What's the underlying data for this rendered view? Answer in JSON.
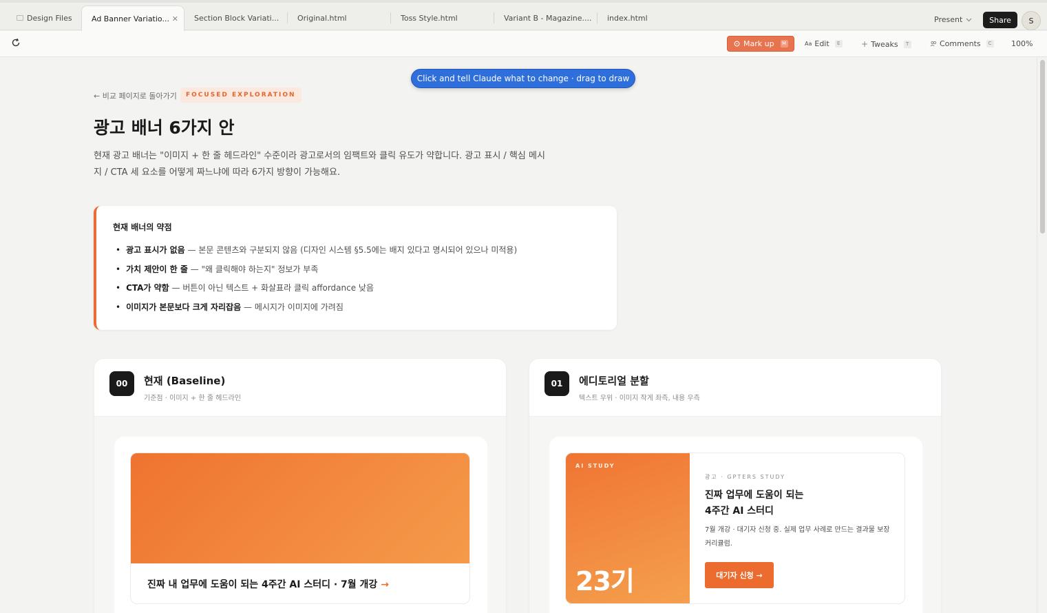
{
  "tabs": [
    {
      "label": "Design Files"
    },
    {
      "label": "Ad Banner Variatio...",
      "active": true
    },
    {
      "label": "Section Block Variati..."
    },
    {
      "label": "Original.html"
    },
    {
      "label": "Toss Style.html"
    },
    {
      "label": "Variant B - Magazine...."
    },
    {
      "label": "index.html"
    }
  ],
  "header": {
    "present_label": "Present",
    "share_label": "Share",
    "avatar_initial": "S"
  },
  "toolbar": {
    "markup_label": "Mark up",
    "markup_key": "M",
    "edit_label": "Edit",
    "edit_key": "E",
    "tweaks_label": "Tweaks",
    "tweaks_key": "T",
    "comments_label": "Comments",
    "comments_key": "C",
    "zoom": "100%"
  },
  "hint": "Click and tell Claude what to change · drag to draw",
  "page": {
    "back_link": "← 비교 페이지로 돌아가기",
    "badge": "FOCUSED EXPLORATION",
    "title": "광고 배너 6가지 안",
    "description": "현재 광고 배너는 \"이미지 + 한 줄 헤드라인\" 수준이라 광고로서의 임팩트와 클릭 유도가 약합니다. 광고 표시 / 핵심 메시지 / CTA 세 요소를 어떻게 짜느냐에 따라 6가지 방향이 가능해요."
  },
  "weaknesses": {
    "title": "현재 배너의 약점",
    "items": [
      {
        "bold": "광고 표시가 없음",
        "text": " — 본문 콘텐츠와 구분되지 않음 (디자인 시스템 §5.5에는 배지 있다고 명시되어 있으나 미적용)"
      },
      {
        "bold": "가치 제안이 한 줄",
        "text": " — \"왜 클릭해야 하는지\" 정보가 부족"
      },
      {
        "bold": "CTA가 약함",
        "text": " — 버튼이 아닌 텍스트 + 화살표라 클릭 affordance 낮음"
      },
      {
        "bold": "이미지가 본문보다 크게 자리잡음",
        "text": " — 메시지가 이미지에 가려짐"
      }
    ]
  },
  "cards": [
    {
      "num": "00",
      "title": "현재 (Baseline)",
      "subtitle": "기준점 · 이미지 + 한 줄 헤드라인",
      "banner_headline": "진짜 내 업무에 도움이 되는 4주간 AI 스터디 · 7월 개강",
      "banner_arrow": "→"
    },
    {
      "num": "01",
      "title": "에디토리얼 분할",
      "subtitle": "텍스트 우위 · 이미지 작게 좌측, 내용 우측",
      "banner_tag": "AI STUDY",
      "banner_big": "23기",
      "banner_label": "광고 · GPTERS STUDY",
      "banner_headline_1": "진짜 업무에 도움이 되는",
      "banner_headline_2": "4주간 AI 스터디",
      "banner_desc": "7월 개강 · 대기자 신청 중. 실제 업무 사례로 만드는 결과물 보장 커리큘럼.",
      "banner_cta": "대기자 신청 →"
    }
  ],
  "colors": {
    "accent": "#ec6b2f",
    "hint_blue": "#2f6fdc",
    "markup": "#e8734f"
  }
}
